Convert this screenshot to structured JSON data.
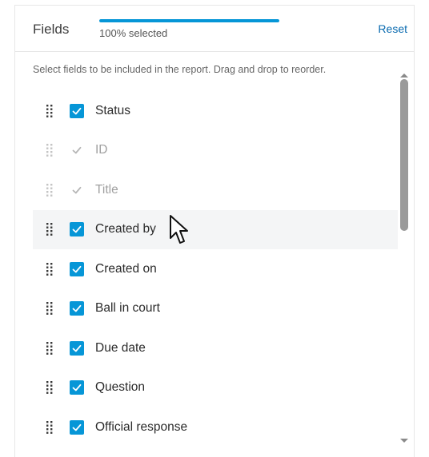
{
  "header": {
    "title": "Fields",
    "progress_text": "100% selected",
    "progress_fraction": 1.0,
    "reset_label": "Reset"
  },
  "help_text": "Select fields to be included in the report. Drag and drop to reorder.",
  "fields": [
    {
      "label": "Status",
      "checked": true,
      "disabled": false
    },
    {
      "label": "ID",
      "checked": true,
      "disabled": true
    },
    {
      "label": "Title",
      "checked": true,
      "disabled": true
    },
    {
      "label": "Created by",
      "checked": true,
      "disabled": false
    },
    {
      "label": "Created on",
      "checked": true,
      "disabled": false
    },
    {
      "label": "Ball in court",
      "checked": true,
      "disabled": false
    },
    {
      "label": "Due date",
      "checked": true,
      "disabled": false
    },
    {
      "label": "Question",
      "checked": true,
      "disabled": false
    },
    {
      "label": "Official response",
      "checked": true,
      "disabled": false
    }
  ],
  "colors": {
    "accent": "#0696d7",
    "link": "#0a6bb0",
    "hover_row": "#f4f5f6"
  },
  "icons": {
    "drag": "drag-handle-icon",
    "check": "check-icon",
    "cursor": "mouse-pointer-icon"
  }
}
